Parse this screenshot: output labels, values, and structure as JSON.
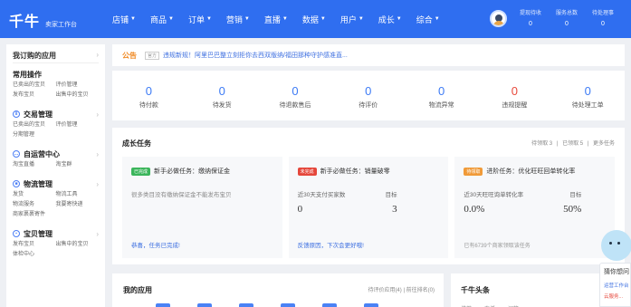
{
  "header": {
    "logo_main": "千牛",
    "logo_sub": "卖家工作台",
    "nav": [
      "店铺",
      "商品",
      "订单",
      "营销",
      "直播",
      "数据",
      "用户",
      "成长",
      "综合"
    ],
    "stats": [
      {
        "label": "提现待收",
        "value": "0"
      },
      {
        "label": "服务总数",
        "value": "0"
      },
      {
        "label": "待处理事",
        "value": "0"
      }
    ]
  },
  "sidebar": {
    "title": "我订购的应用",
    "sections": [
      {
        "title": "常用操作",
        "icon": "",
        "links": [
          "已卖出的宝贝",
          "评价管理",
          "发布宝贝",
          "出售中的宝贝"
        ]
      },
      {
        "title": "交易管理",
        "icon": "trade-icon",
        "links": [
          "已卖出的宝贝",
          "评价管理",
          "分期管理"
        ]
      },
      {
        "title": "自运营中心",
        "icon": "chat-icon",
        "links": [
          "淘宝直播",
          "淘宝群"
        ]
      },
      {
        "title": "物流管理",
        "icon": "truck-icon",
        "links": [
          "发货",
          "物流工具",
          "物流服务",
          "我要寄快递",
          "商家裹裹寄件"
        ]
      },
      {
        "title": "宝贝管理",
        "icon": "box-icon",
        "links": [
          "发布宝贝",
          "出售中的宝贝",
          "体检中心"
        ]
      }
    ]
  },
  "notice": {
    "label": "公告",
    "tag": "官方",
    "text": "违规新规！阿里巴巴整立刻拒你去西双版纳/福田那种守护感准直..."
  },
  "orders": [
    {
      "value": "0",
      "label": "待付款"
    },
    {
      "value": "0",
      "label": "待发货"
    },
    {
      "value": "0",
      "label": "待退款售后"
    },
    {
      "value": "0",
      "label": "待评价"
    },
    {
      "value": "0",
      "label": "物流异常"
    },
    {
      "value": "0",
      "label": "违规提醒"
    },
    {
      "value": "0",
      "label": "待处理工单"
    }
  ],
  "growth": {
    "title": "成长任务",
    "meta": [
      "待领取 3",
      "|",
      "已领取 5",
      "|",
      "更多任务"
    ],
    "tasks": [
      {
        "badge": "已完成",
        "title": "新手必做任务：缴纳保证金",
        "desc": "很多类目没有缴纳保证金不能发布宝贝",
        "link": "恭喜，任务已完成!"
      },
      {
        "badge": "未完成",
        "title": "新手必做任务：销量破零",
        "metric_label": "近30天支付买家数",
        "target_label": "目标",
        "value": "0",
        "target": "3",
        "link": "反馈原因，下次会更好哦!"
      },
      {
        "badge": "待领取",
        "title": "进阶任务：优化旺旺回单转化率",
        "metric_label": "近30天旺旺询单转化率",
        "target_label": "目标",
        "value": "0.0%",
        "target": "50%",
        "foot": "已有6739个商家领取该任务"
      }
    ]
  },
  "apps": {
    "title": "我的应用",
    "meta": "待评价应用(4) | 前往排名(0)"
  },
  "headlines": {
    "title": "千牛头条",
    "tabs": [
      "推荐",
      "直播",
      "问答"
    ]
  },
  "helper": {
    "title": "猜你想问",
    "link1": "运营工作台",
    "link2": "云服务..."
  }
}
